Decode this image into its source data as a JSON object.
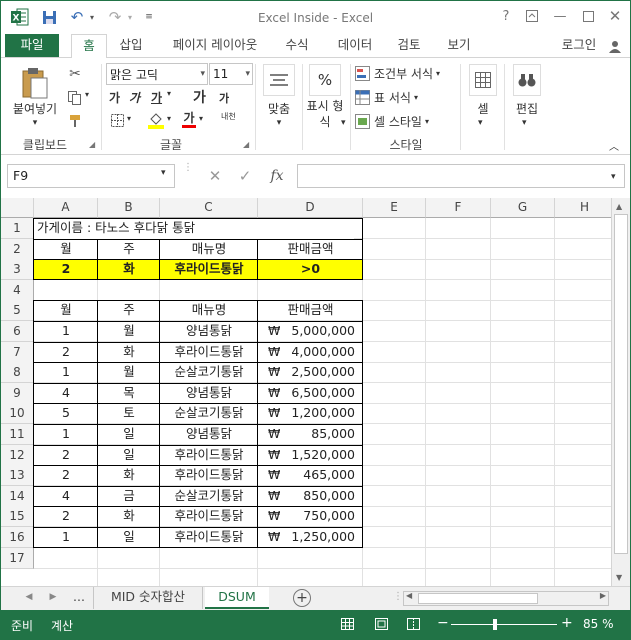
{
  "app": {
    "title": "Excel Inside - Excel",
    "help_icon": "?"
  },
  "tabs": {
    "file": "파일",
    "home": "홈",
    "insert": "삽입",
    "layout": "페이지 레이아웃",
    "formulas": "수식",
    "data": "데이터",
    "review": "검토",
    "view": "보기",
    "login": "로그인"
  },
  "ribbon": {
    "clipboard": {
      "paste": "붙여넣기",
      "label": "클립보드"
    },
    "font": {
      "name": "맑은 고딕",
      "size": "11",
      "bold": "가",
      "italic": "가",
      "underline": "가",
      "grow": "가",
      "shrink": "가",
      "color_letter": "가",
      "phonetic": "내천",
      "label": "글꼴"
    },
    "align": {
      "label": "맞춤"
    },
    "number": {
      "label": "표시 형식",
      "symbol": "%"
    },
    "styles": {
      "cond": "조건부 서식",
      "table": "표 서식",
      "cell": "셀 스타일",
      "label": "스타일"
    },
    "cells": {
      "label": "셀"
    },
    "edit": {
      "label": "편집"
    }
  },
  "formula_bar": {
    "name_box": "F9",
    "formula": "",
    "fx": "fx"
  },
  "columns": [
    "A",
    "B",
    "C",
    "D",
    "E",
    "F",
    "G",
    "H"
  ],
  "rows": [
    "1",
    "2",
    "3",
    "4",
    "5",
    "6",
    "7",
    "8",
    "9",
    "10",
    "11",
    "12",
    "13",
    "14",
    "15",
    "16",
    "17"
  ],
  "sheet": {
    "r1": "가게이름 : 타노스 후다닭 통닭",
    "criteria_headers": [
      "월",
      "주",
      "매뉴명",
      "판매금액"
    ],
    "criteria_values": [
      "2",
      "화",
      "후라이드통닭",
      ">0"
    ],
    "table_headers": [
      "월",
      "주",
      "매뉴명",
      "판매금액"
    ],
    "currency": "₩",
    "table_rows": [
      [
        "1",
        "월",
        "양념통닭",
        "5,000,000"
      ],
      [
        "2",
        "화",
        "후라이드통닭",
        "4,000,000"
      ],
      [
        "1",
        "월",
        "순살코기통닭",
        "2,500,000"
      ],
      [
        "4",
        "목",
        "양념통닭",
        "6,500,000"
      ],
      [
        "5",
        "토",
        "순살코기통닭",
        "1,200,000"
      ],
      [
        "1",
        "일",
        "양념통닭",
        "85,000"
      ],
      [
        "2",
        "일",
        "후라이드통닭",
        "1,520,000"
      ],
      [
        "2",
        "화",
        "후라이드통닭",
        "465,000"
      ],
      [
        "4",
        "금",
        "순살코기통닭",
        "850,000"
      ],
      [
        "2",
        "화",
        "후라이드통닭",
        "750,000"
      ],
      [
        "1",
        "일",
        "후라이드통닭",
        "1,250,000"
      ]
    ]
  },
  "sheet_tabs": {
    "ellipsis": "...",
    "tab1": "MID 숫자합산",
    "tab2": "DSUM",
    "add": "+"
  },
  "status": {
    "ready": "준비",
    "calc": "계산",
    "zoom": "85 %"
  },
  "colors": {
    "accent": "#217346",
    "highlight": "#ffff00"
  }
}
